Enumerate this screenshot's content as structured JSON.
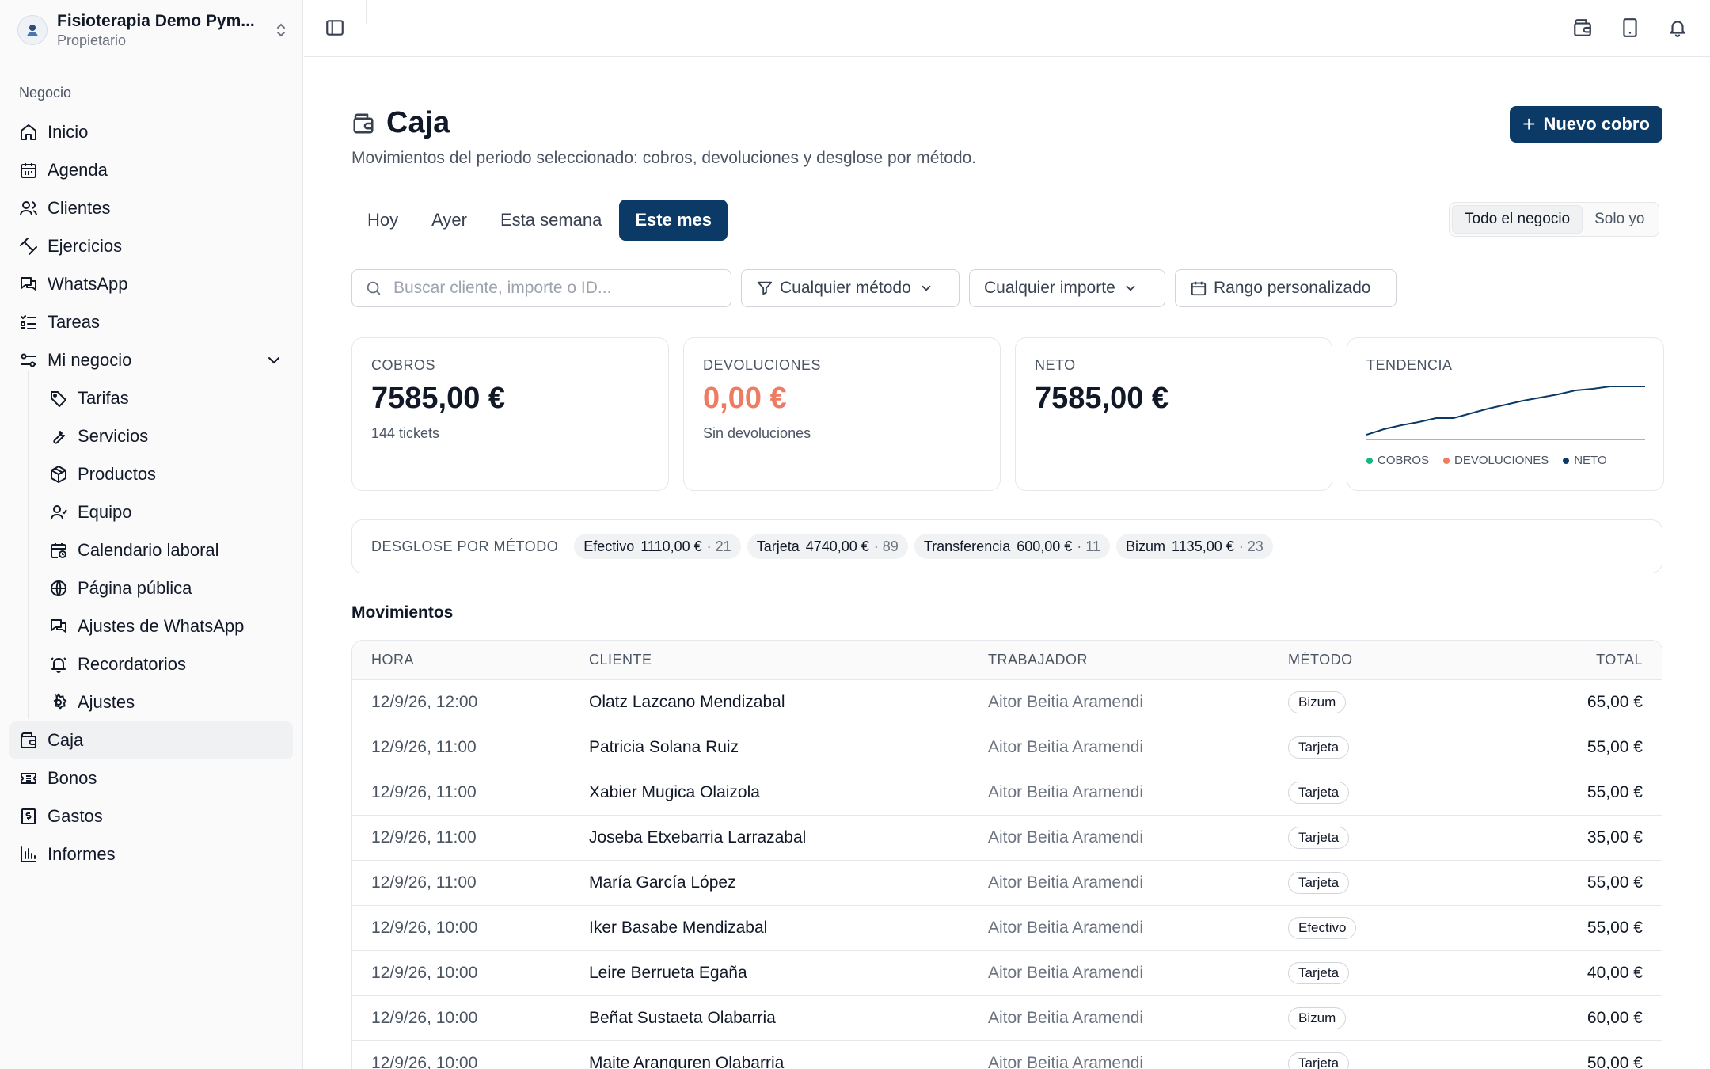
{
  "org": {
    "name": "Fisioterapia Demo Pym...",
    "role": "Propietario"
  },
  "sidebar": {
    "section": "Negocio",
    "items": [
      {
        "label": "Inicio",
        "icon": "home-icon"
      },
      {
        "label": "Agenda",
        "icon": "calendar-icon"
      },
      {
        "label": "Clientes",
        "icon": "users-icon"
      },
      {
        "label": "Ejercicios",
        "icon": "dumbbell-icon"
      },
      {
        "label": "WhatsApp",
        "icon": "chat-icon"
      },
      {
        "label": "Tareas",
        "icon": "tasks-icon"
      },
      {
        "label": "Mi negocio",
        "icon": "settings-sliders-icon"
      },
      {
        "label": "Tarifas",
        "icon": "tag-icon"
      },
      {
        "label": "Servicios",
        "icon": "wrench-icon"
      },
      {
        "label": "Productos",
        "icon": "box-icon"
      },
      {
        "label": "Equipo",
        "icon": "team-icon"
      },
      {
        "label": "Calendario laboral",
        "icon": "calendar-clock-icon"
      },
      {
        "label": "Página pública",
        "icon": "globe-icon"
      },
      {
        "label": "Ajustes de WhatsApp",
        "icon": "chat-icon"
      },
      {
        "label": "Recordatorios",
        "icon": "bell-icon"
      },
      {
        "label": "Ajustes",
        "icon": "gear-icon"
      },
      {
        "label": "Caja",
        "icon": "wallet-icon"
      },
      {
        "label": "Bonos",
        "icon": "ticket-icon"
      },
      {
        "label": "Gastos",
        "icon": "receipt-icon"
      },
      {
        "label": "Informes",
        "icon": "bar-chart-icon"
      }
    ],
    "active": "Caja"
  },
  "page": {
    "title": "Caja",
    "subtitle": "Movimientos del periodo seleccionado: cobros, devoluciones y desglose por método.",
    "new_button": "Nuevo cobro"
  },
  "period_tabs": [
    "Hoy",
    "Ayer",
    "Esta semana",
    "Este mes"
  ],
  "active_period": "Este mes",
  "scope": {
    "options": [
      "Todo el negocio",
      "Solo yo"
    ],
    "active": "Todo el negocio"
  },
  "filters": {
    "search_placeholder": "Buscar cliente, importe o ID...",
    "method": "Cualquier método",
    "amount": "Cualquier importe",
    "range": "Rango personalizado"
  },
  "cards": {
    "cobros": {
      "label": "COBROS",
      "value": "7585,00 €",
      "sub": "144 tickets"
    },
    "devoluciones": {
      "label": "DEVOLUCIONES",
      "value": "0,00 €",
      "sub": "Sin devoluciones"
    },
    "neto": {
      "label": "NETO",
      "value": "7585,00 €"
    },
    "tendencia": {
      "label": "TENDENCIA",
      "legend": [
        "COBROS",
        "DEVOLUCIONES",
        "NETO"
      ]
    }
  },
  "colors": {
    "primary": "#0b3a66",
    "cobros": "#10b981",
    "devoluciones": "#ec7c62",
    "neto": "#0b3a66"
  },
  "breakdown": {
    "label": "DESGLOSE POR MÉTODO",
    "items": [
      {
        "name": "Efectivo",
        "amount": "1110,00 €",
        "count": "· 21"
      },
      {
        "name": "Tarjeta",
        "amount": "4740,00 €",
        "count": "· 89"
      },
      {
        "name": "Transferencia",
        "amount": "600,00 €",
        "count": "· 11"
      },
      {
        "name": "Bizum",
        "amount": "1135,00 €",
        "count": "· 23"
      }
    ]
  },
  "movements": {
    "title": "Movimientos",
    "columns": [
      "HORA",
      "CLIENTE",
      "TRABAJADOR",
      "MÉTODO",
      "TOTAL"
    ],
    "rows": [
      {
        "time": "12/9/26, 12:00",
        "client": "Olatz Lazcano Mendizabal",
        "worker": "Aitor Beitia Aramendi",
        "method": "Bizum",
        "total": "65,00 €"
      },
      {
        "time": "12/9/26, 11:00",
        "client": "Patricia Solana Ruiz",
        "worker": "Aitor Beitia Aramendi",
        "method": "Tarjeta",
        "total": "55,00 €"
      },
      {
        "time": "12/9/26, 11:00",
        "client": "Xabier Mugica Olaizola",
        "worker": "Aitor Beitia Aramendi",
        "method": "Tarjeta",
        "total": "55,00 €"
      },
      {
        "time": "12/9/26, 11:00",
        "client": "Joseba Etxebarria Larrazabal",
        "worker": "Aitor Beitia Aramendi",
        "method": "Tarjeta",
        "total": "35,00 €"
      },
      {
        "time": "12/9/26, 11:00",
        "client": "María García López",
        "worker": "Aitor Beitia Aramendi",
        "method": "Tarjeta",
        "total": "55,00 €"
      },
      {
        "time": "12/9/26, 10:00",
        "client": "Iker Basabe Mendizabal",
        "worker": "Aitor Beitia Aramendi",
        "method": "Efectivo",
        "total": "55,00 €"
      },
      {
        "time": "12/9/26, 10:00",
        "client": "Leire Berrueta Egaña",
        "worker": "Aitor Beitia Aramendi",
        "method": "Tarjeta",
        "total": "40,00 €"
      },
      {
        "time": "12/9/26, 10:00",
        "client": "Beñat Sustaeta Olabarria",
        "worker": "Aitor Beitia Aramendi",
        "method": "Bizum",
        "total": "60,00 €"
      },
      {
        "time": "12/9/26, 10:00",
        "client": "Maite Aranguren Olabarria",
        "worker": "Aitor Beitia Aramendi",
        "method": "Tarjeta",
        "total": "50,00 €"
      }
    ]
  }
}
